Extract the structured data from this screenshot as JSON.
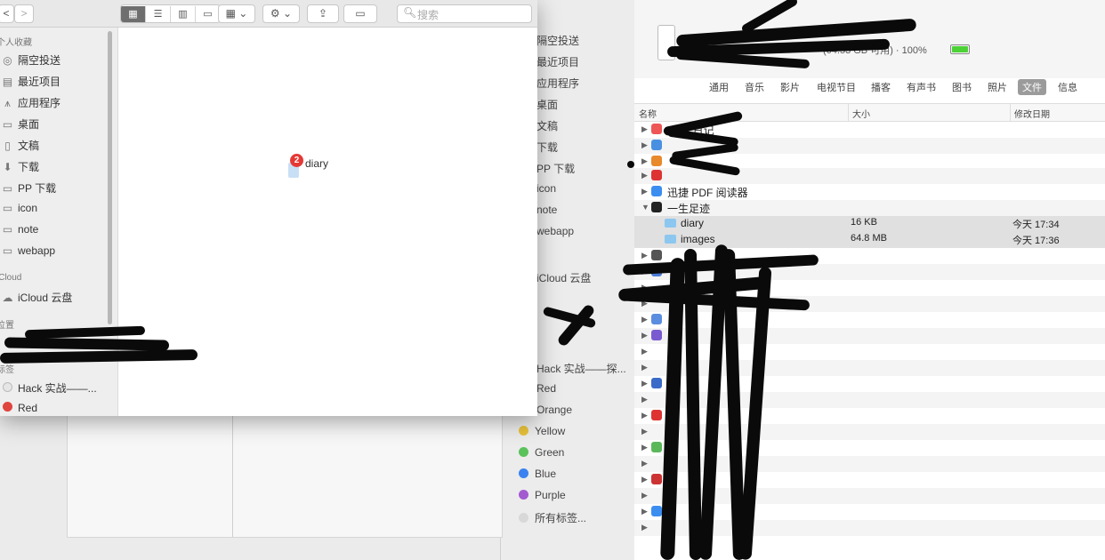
{
  "finder": {
    "toolbar": {
      "back": "<",
      "forward": ">",
      "search_placeholder": "搜索"
    },
    "sidebar": {
      "favorites_header": "个人收藏",
      "favorites": [
        {
          "label": "隔空投送",
          "icon": "airdrop-icon"
        },
        {
          "label": "最近项目",
          "icon": "recents-icon"
        },
        {
          "label": "应用程序",
          "icon": "applications-icon"
        },
        {
          "label": "桌面",
          "icon": "desktop-icon"
        },
        {
          "label": "文稿",
          "icon": "documents-icon"
        },
        {
          "label": "下载",
          "icon": "downloads-icon"
        },
        {
          "label": "PP 下载",
          "icon": "folder-icon"
        },
        {
          "label": "icon",
          "icon": "folder-icon"
        },
        {
          "label": "note",
          "icon": "folder-icon"
        },
        {
          "label": "webapp",
          "icon": "folder-icon"
        }
      ],
      "icloud_header": "iCloud",
      "icloud": [
        {
          "label": "iCloud 云盘",
          "icon": "cloud-icon"
        }
      ],
      "locations_header": "位置",
      "tags_header": "标签",
      "tags": [
        {
          "label": "Hack 实战——...",
          "color": "#d8d8d8"
        },
        {
          "label": "Red",
          "color": "#e0443e"
        }
      ]
    },
    "content": {
      "file_name": "diary",
      "badge_count": "2"
    }
  },
  "device_window": {
    "sidebar": {
      "items": [
        "隔空投送",
        "最近项目",
        "应用程序",
        "桌面",
        "文稿",
        "下载",
        "PP 下载",
        "icon",
        "note",
        "webapp",
        "iCloud 云盘",
        "Hack 实战——探...",
        "Red",
        "Orange"
      ],
      "tags": [
        {
          "label": "Yellow",
          "color": "#e8c23c"
        },
        {
          "label": "Green",
          "color": "#5ac25a"
        },
        {
          "label": "Blue",
          "color": "#3b82f0"
        },
        {
          "label": "Purple",
          "color": "#a35ad1"
        },
        {
          "label": "所有标签...",
          "color": "#d8d8d8"
        }
      ]
    },
    "header": {
      "storage": "(64.53 GB 可用) · 100%"
    },
    "tabs": [
      "通用",
      "音乐",
      "影片",
      "电视节目",
      "播客",
      "有声书",
      "图书",
      "照片",
      "文件",
      "信息"
    ],
    "active_tab": "文件",
    "columns": {
      "name": "名称",
      "size": "大小",
      "modified": "修改日期"
    },
    "rows": [
      {
        "name": "10 年日记",
        "icon_color": "#e55",
        "level": 0
      },
      {
        "name": "迅捷 PDF 阅读器",
        "icon_color": "#3b8ef0",
        "level": 0
      },
      {
        "name": "一生足迹",
        "icon_color": "#222",
        "level": 0,
        "expanded": true
      },
      {
        "name": "diary",
        "size": "16 KB",
        "modified": "今天 17:34",
        "level": 1
      },
      {
        "name": "images",
        "size": "64.8 MB",
        "modified": "今天 17:36",
        "level": 1
      }
    ]
  }
}
